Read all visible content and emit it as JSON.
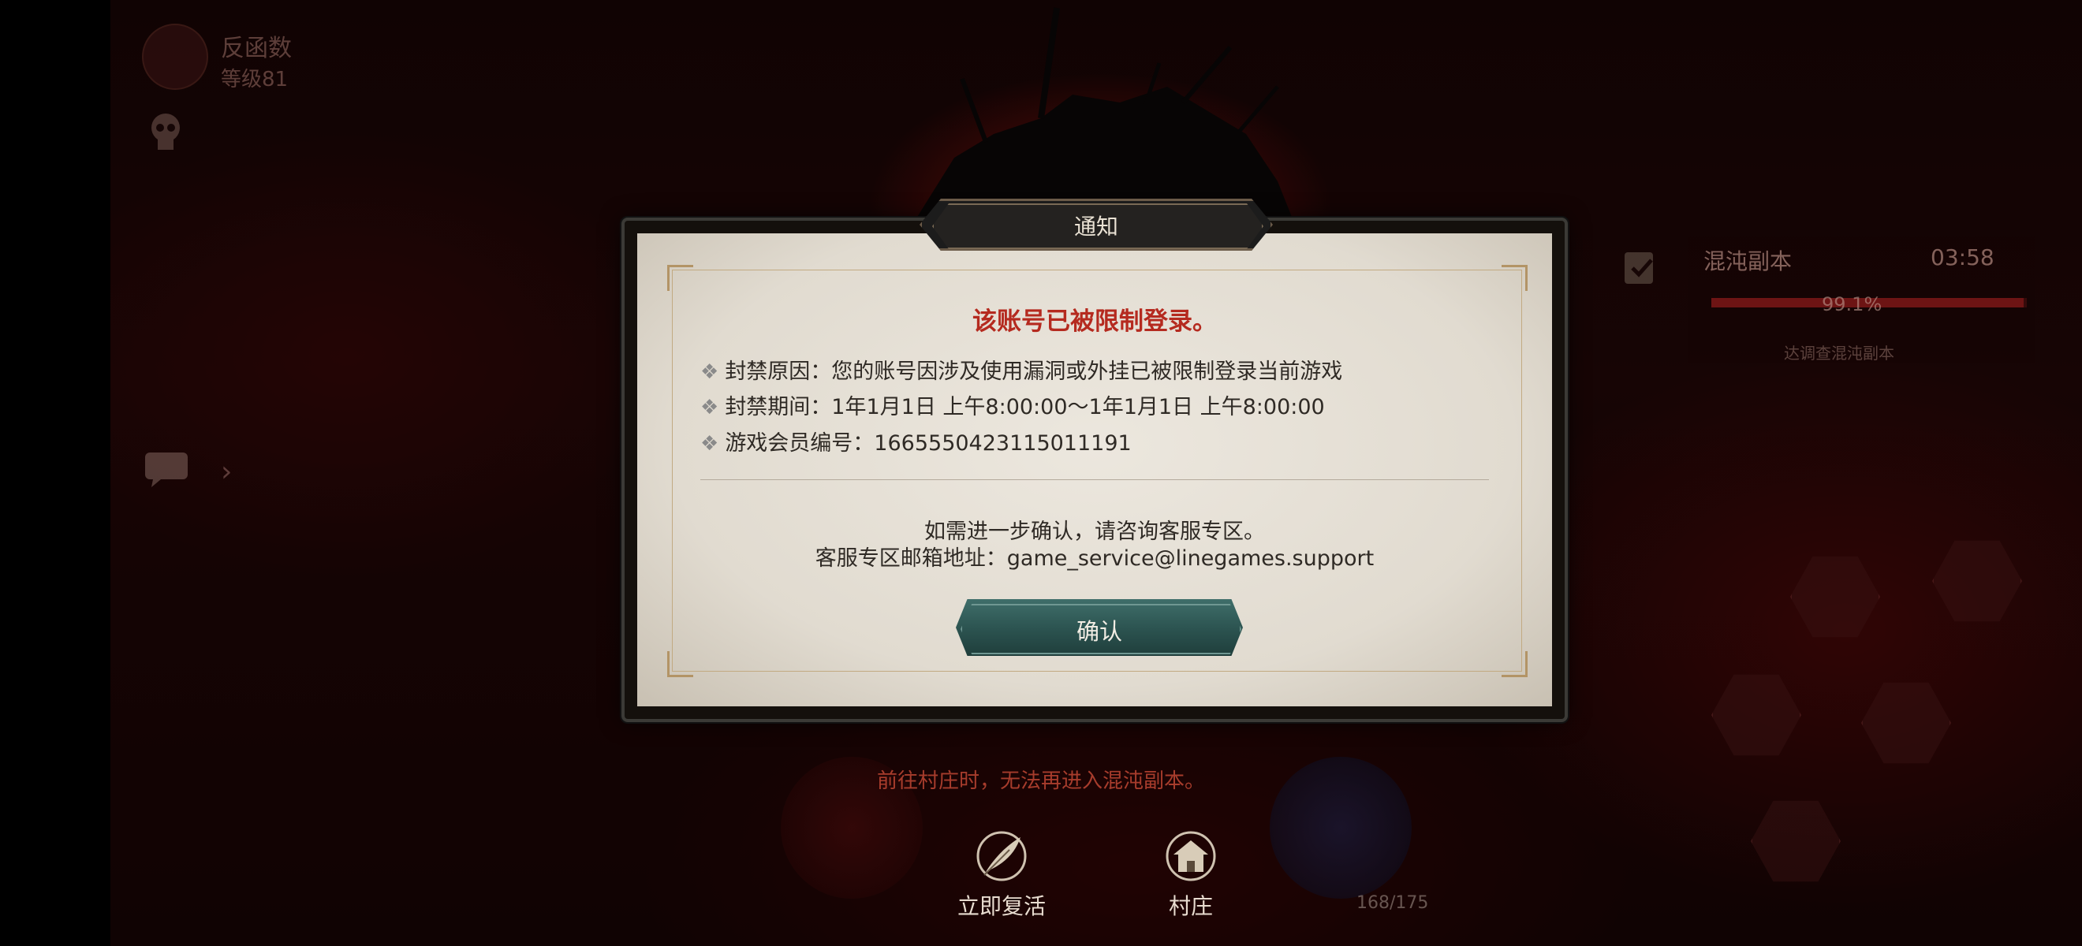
{
  "player": {
    "name": "反函数",
    "level": "等级81"
  },
  "dungeon": {
    "title": "混沌副本",
    "timer": "03:58",
    "progress_text": "99.1%",
    "progress": 0.991,
    "hint": "达调查混沌副本"
  },
  "dialog": {
    "title": "通知",
    "heading": "该账号已被限制登录。",
    "lines": [
      "封禁原因：您的账号因涉及使用漏洞或外挂已被限制登录当前游戏",
      "封禁期间：1年1月1日 上午8:00:00～1年1月1日 上午8:00:00",
      "游戏会员编号：1665550423115011191"
    ],
    "contact_line1": "如需进一步确认，请咨询客服专区。",
    "contact_line2": "客服专区邮箱地址：game_service@linegames.support",
    "confirm_label": "确认"
  },
  "bullet": "❖",
  "village_warning": "前往村庄时，无法再进入混沌副本。",
  "bottom": {
    "revive_label": "立即复活",
    "village_label": "村庄",
    "inventory": "168/175"
  },
  "colors": {
    "heading_red": "#b52a1f",
    "button_teal": "#2b524f",
    "warning_red": "#d6503a"
  }
}
